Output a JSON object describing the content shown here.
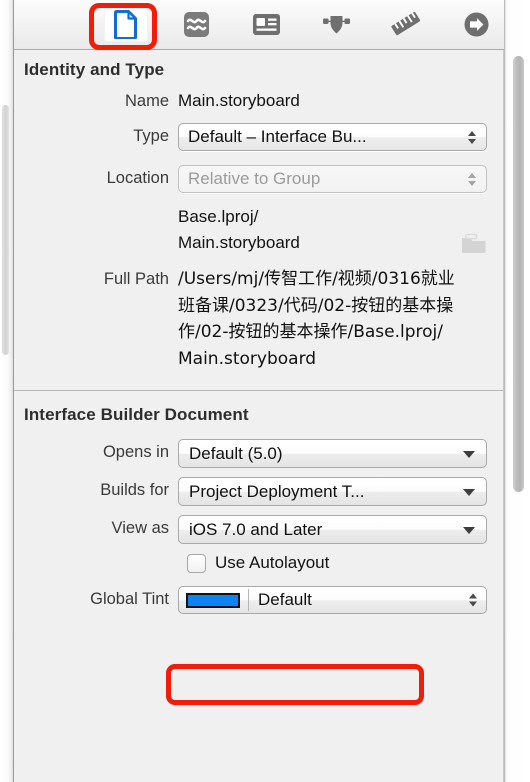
{
  "window": {
    "panel_title": "File Inspector"
  },
  "toolbar": {
    "tabs": [
      {
        "name": "file-inspector",
        "icon": "document-icon",
        "label": "File Inspector",
        "selected": true
      },
      {
        "name": "quick-help-inspector",
        "icon": "waves-icon",
        "label": "Quick Help Inspector",
        "selected": false
      },
      {
        "name": "identity-inspector",
        "icon": "identity-card-icon",
        "label": "Identity Inspector",
        "selected": false
      },
      {
        "name": "attributes-inspector",
        "icon": "shield-slider-icon",
        "label": "Attributes Inspector",
        "selected": false
      },
      {
        "name": "size-inspector",
        "icon": "ruler-icon",
        "label": "Size Inspector",
        "selected": false
      },
      {
        "name": "connections-inspector",
        "icon": "arrow-circle-icon",
        "label": "Connections Inspector",
        "selected": false
      }
    ]
  },
  "identity_section": {
    "title": "Identity and Type",
    "name_label": "Name",
    "name_value": "Main.storyboard",
    "type_label": "Type",
    "type_value": "Default – Interface Bu...",
    "location_label": "Location",
    "location_value": "Relative to Group",
    "relative_path": "Base.lproj/\nMain.storyboard",
    "folder_icon": "folder-icon",
    "full_path_label": "Full Path",
    "full_path_value": "/Users/mj/传智工作/视频/0316就业班备课/0323/代码/02-按钮的基本操作/02-按钮的基本操作/Base.lproj/Main.storyboard",
    "reveal_icon": "arrow-circle-right-icon"
  },
  "ib_section": {
    "title": "Interface Builder Document",
    "opens_in_label": "Opens in",
    "opens_in_value": "Default (5.0)",
    "builds_for_label": "Builds for",
    "builds_for_value": "Project Deployment T...",
    "view_as_label": "View as",
    "view_as_value": "iOS 7.0 and Later",
    "autolayout_label": "Use Autolayout",
    "autolayout_checked": false,
    "global_tint_label": "Global Tint",
    "global_tint_value": "Default",
    "global_tint_color": "#0b84f3"
  },
  "annotations": {
    "highlight_color": "#f21c07",
    "boxes": [
      {
        "name": "file-inspector-tab-highlight",
        "target": "file-inspector-tab"
      },
      {
        "name": "use-autolayout-highlight",
        "target": "use-autolayout-checkbox"
      }
    ]
  }
}
